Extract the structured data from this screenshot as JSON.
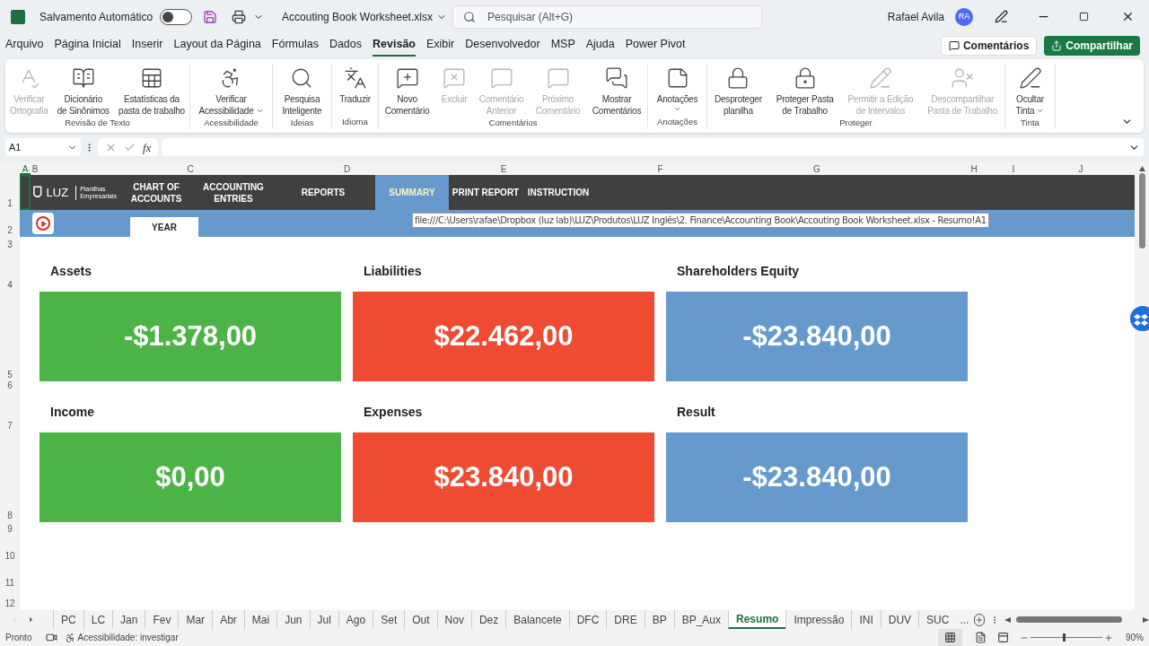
{
  "title_bar": {
    "autosave_label": "Salvamento Automático",
    "autosave_on": false,
    "filename": "Accouting Book Worksheet.xlsx",
    "search_placeholder": "Pesquisar (Alt+G)",
    "user_name": "Rafael Avila",
    "user_initials": "RA"
  },
  "menu_tabs": [
    {
      "label": "Arquivo",
      "selected": false
    },
    {
      "label": "Página Inicial",
      "selected": false
    },
    {
      "label": "Inserir",
      "selected": false
    },
    {
      "label": "Layout da Página",
      "selected": false
    },
    {
      "label": "Fórmulas",
      "selected": false
    },
    {
      "label": "Dados",
      "selected": false
    },
    {
      "label": "Revisão",
      "selected": true
    },
    {
      "label": "Exibir",
      "selected": false
    },
    {
      "label": "Desenvolvedor",
      "selected": false
    },
    {
      "label": "MSP",
      "selected": false
    },
    {
      "label": "Ajuda",
      "selected": false
    },
    {
      "label": "Power Pivot",
      "selected": false
    }
  ],
  "comments_button": "Comentários",
  "share_button": "Compartilhar",
  "ribbon_groups": [
    {
      "name": "Revisão de Texto",
      "buttons": [
        {
          "lines": [
            "Verificar",
            "Ortografia"
          ],
          "disabled": true,
          "dropdown": false
        },
        {
          "lines": [
            "Dicionário",
            "de Sinônimos"
          ],
          "disabled": false,
          "dropdown": false
        },
        {
          "lines": [
            "Estatísticas da",
            "pasta de trabalho"
          ],
          "disabled": false,
          "dropdown": false
        }
      ]
    },
    {
      "name": "Acessibilidade",
      "buttons": [
        {
          "lines": [
            "Verificar",
            "Acessibilidade"
          ],
          "disabled": false,
          "dropdown": true
        }
      ]
    },
    {
      "name": "Ideias",
      "buttons": [
        {
          "lines": [
            "Pesquisa",
            "Inteligente"
          ],
          "disabled": false,
          "dropdown": false
        }
      ]
    },
    {
      "name": "Idioma",
      "buttons": [
        {
          "lines": [
            "Traduzir"
          ],
          "disabled": false,
          "dropdown": false
        }
      ]
    },
    {
      "name": "Comentários",
      "buttons": [
        {
          "lines": [
            "Novo",
            "Comentário"
          ],
          "disabled": false,
          "dropdown": false
        },
        {
          "lines": [
            "Excluir"
          ],
          "disabled": true,
          "dropdown": false
        },
        {
          "lines": [
            "Comentário",
            "Anterior"
          ],
          "disabled": true,
          "dropdown": false
        },
        {
          "lines": [
            "Próximo",
            "Comentário"
          ],
          "disabled": true,
          "dropdown": false
        },
        {
          "lines": [
            "Mostrar",
            "Comentários"
          ],
          "disabled": false,
          "dropdown": false
        }
      ]
    },
    {
      "name": "Anotações",
      "buttons": [
        {
          "lines": [
            "Anotações"
          ],
          "disabled": false,
          "dropdown": true
        }
      ]
    },
    {
      "name": "Proteger",
      "buttons": [
        {
          "lines": [
            "Desproteger",
            "planilha"
          ],
          "disabled": false,
          "dropdown": false
        },
        {
          "lines": [
            "Proteger Pasta",
            "de Trabalho"
          ],
          "disabled": false,
          "dropdown": false
        },
        {
          "lines": [
            "Permitir a Edição",
            "de Intervalos"
          ],
          "disabled": true,
          "dropdown": false
        },
        {
          "lines": [
            "Descompartilhar",
            "Pasta de Trabalho"
          ],
          "disabled": true,
          "dropdown": false
        }
      ]
    },
    {
      "name": "Tinta",
      "buttons": [
        {
          "lines": [
            "Ocultar",
            "Tinta"
          ],
          "disabled": false,
          "dropdown": true
        }
      ]
    }
  ],
  "formula_bar": {
    "name_box": "A1",
    "function_label": "fx"
  },
  "column_headers": [
    "A",
    "B",
    "C",
    "D",
    "E",
    "F",
    "G",
    "H",
    "I",
    "J"
  ],
  "row_numbers": [
    "1",
    "2",
    "3",
    "4",
    "5",
    "6",
    "7",
    "8",
    "9",
    "10",
    "11",
    "12"
  ],
  "sheet": {
    "logo_text": "LUZ",
    "logo_subtitle": [
      "Planilhas",
      "Empresariais"
    ],
    "nav_items": [
      {
        "lines": [
          "CHART OF",
          "ACCOUNTS"
        ],
        "selected": false
      },
      {
        "lines": [
          "ACCOUNTING",
          "ENTRIES"
        ],
        "selected": false
      },
      {
        "lines": [
          "REPORTS"
        ],
        "selected": false
      },
      {
        "lines": [
          "SUMMARY"
        ],
        "selected": true
      },
      {
        "lines": [
          "PRINT REPORT"
        ],
        "selected": false
      },
      {
        "lines": [
          "INSTRUCTION"
        ],
        "selected": false
      }
    ],
    "year_tab": "YEAR",
    "tooltip": "file:///C:\\Users\\rafae\\Dropbox (luz lab)\\LUZ\\Produtos\\LUZ Inglês\\2. Finance\\Accounting Book\\Accouting Book Worksheet.xlsx - Resumo!A1",
    "cards": [
      {
        "title": "Assets",
        "value": "-$1.378,00",
        "color": "#4cb447"
      },
      {
        "title": "Liabilities",
        "value": "$22.462,00",
        "color": "#ef4b33"
      },
      {
        "title": "Shareholders Equity",
        "value": "-$23.840,00",
        "color": "#6699cc"
      },
      {
        "title": "Income",
        "value": "$0,00",
        "color": "#4cb447"
      },
      {
        "title": "Expenses",
        "value": "$23.840,00",
        "color": "#ef4b33"
      },
      {
        "title": "Result",
        "value": "-$23.840,00",
        "color": "#6699cc"
      }
    ]
  },
  "sheet_tabs": [
    {
      "label": "PC",
      "selected": false
    },
    {
      "label": "LC",
      "selected": false
    },
    {
      "label": "Jan",
      "selected": false
    },
    {
      "label": "Fev",
      "selected": false
    },
    {
      "label": "Mar",
      "selected": false
    },
    {
      "label": "Abr",
      "selected": false
    },
    {
      "label": "Mai",
      "selected": false
    },
    {
      "label": "Jun",
      "selected": false
    },
    {
      "label": "Jul",
      "selected": false
    },
    {
      "label": "Ago",
      "selected": false
    },
    {
      "label": "Set",
      "selected": false
    },
    {
      "label": "Out",
      "selected": false
    },
    {
      "label": "Nov",
      "selected": false
    },
    {
      "label": "Dez",
      "selected": false
    },
    {
      "label": "Balancete",
      "selected": false
    },
    {
      "label": "DFC",
      "selected": false
    },
    {
      "label": "DRE",
      "selected": false
    },
    {
      "label": "BP",
      "selected": false
    },
    {
      "label": "BP_Aux",
      "selected": false
    },
    {
      "label": "Resumo",
      "selected": true
    },
    {
      "label": "Impressão",
      "selected": false
    },
    {
      "label": "INI",
      "selected": false
    },
    {
      "label": "DUV",
      "selected": false
    },
    {
      "label": "SUC",
      "selected": false
    }
  ],
  "tabs_overflow": "...",
  "status_bar": {
    "state": "Pronto",
    "accessibility": "Acessibilidade: investigar",
    "zoom": "90%",
    "zoom_slider": {
      "level": 0.45
    }
  }
}
